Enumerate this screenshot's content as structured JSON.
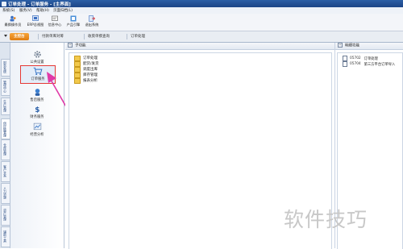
{
  "window": {
    "title": "订单处理 - 订单服务 - [主界面]"
  },
  "menu": [
    "系统(S)",
    "服务(V)",
    "帮助(H)",
    "页面归档(L)"
  ],
  "toolbar": [
    {
      "label": "最换操作员",
      "icon": "switch-user-icon"
    },
    {
      "label": "ERP总视图",
      "icon": "erp-view-icon"
    },
    {
      "label": "信息中心",
      "icon": "info-center-icon"
    },
    {
      "label": "产品引擎",
      "icon": "product-engine-icon"
    },
    {
      "label": "退出系统",
      "icon": "exit-icon"
    }
  ],
  "tabs": [
    {
      "label": "主控台",
      "active": true
    },
    {
      "label": "付款单库对筹",
      "active": false
    },
    {
      "label": "收莫单摸查询",
      "active": false
    },
    {
      "label": "订单处理",
      "active": false
    }
  ],
  "vertical_tabs": [
    "财务系统",
    "管理中心",
    "生产管理",
    "供应链管理",
    "仓库管理",
    "客户关系",
    "人力资源",
    "资产管理",
    "辅助工具"
  ],
  "modules": [
    {
      "label": "公共设置",
      "icon": "gear-icon"
    },
    {
      "label": "订单服务",
      "icon": "cart-icon",
      "selected": true
    },
    {
      "label": "售后服务",
      "icon": "service-icon"
    },
    {
      "label": "财务服务",
      "icon": "finance-icon"
    },
    {
      "label": "经营分析",
      "icon": "chart-icon"
    }
  ],
  "center": {
    "header": "子功能",
    "items": [
      "订单处理",
      "配货/发货",
      "调度出库",
      "库存管理",
      "报表分析"
    ]
  },
  "right": {
    "header": "明细功能",
    "items": [
      {
        "code": "05702",
        "label": "订单处理"
      },
      {
        "code": "05704",
        "label": "第三方平台订单导入"
      }
    ]
  },
  "watermark": "软件技巧",
  "colors": {
    "accent": "#e8891a",
    "selection_border": "#e53935",
    "arrow": "#e03aa8",
    "title_bar": "#2c5fa6"
  }
}
